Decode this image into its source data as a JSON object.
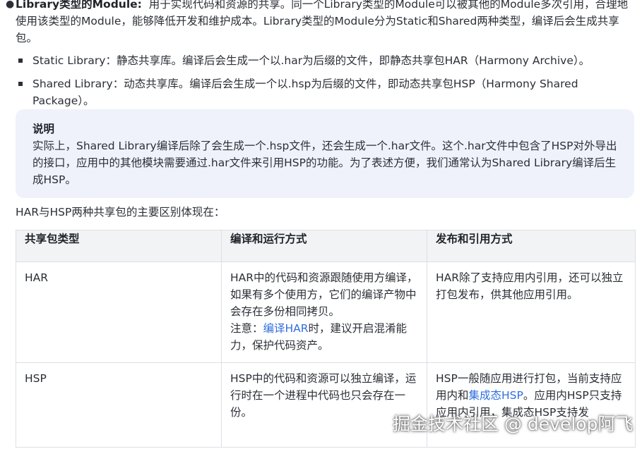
{
  "intro_item": {
    "title": "Library类型的Module:",
    "text": "用于实现代码和资源的共享。同一个Library类型的Module可以被其他的Module多次引用，合理地使用该类型的Module，能够降低开发和维护成本。Library类型的Module分为Static和Shared两种类型，编译后会生成共享包。",
    "sub_items": [
      {
        "text": "Static Library：静态共享库。编译后会生成一个以.har为后缀的文件，即静态共享包HAR（Harmony Archive）。"
      },
      {
        "text": "Shared Library：动态共享库。编译后会生成一个以.hsp为后缀的文件，即动态共享包HSP（Harmony Shared Package）。"
      }
    ]
  },
  "note": {
    "title": "说明",
    "body": "实际上，Shared Library编译后除了会生成一个.hsp文件，还会生成一个.har文件。这个.har文件中包含了HSP对外导出的接口，应用中的其他模块需要通过.har文件来引用HSP的功能。为了表述方便，我们通常认为Shared Library编译后生成HSP。"
  },
  "table_intro": "HAR与HSP两种共享包的主要区别体现在：",
  "table": {
    "headers": [
      "共享包类型",
      "编译和运行方式",
      "发布和引用方式"
    ],
    "har": {
      "type": "HAR",
      "compile": "HAR中的代码和资源跟随使用方编译，如果有多个使用方，它们的编译产物中会存在多份相同拷贝。",
      "note_prefix": "注意：",
      "note_link": "编译HAR",
      "note_suffix": "时，建议开启混淆能力，保护代码资产。",
      "publish": "HAR除了支持应用内引用，还可以独立打包发布，供其他应用引用。"
    },
    "hsp": {
      "type": "HSP",
      "compile": "HSP中的代码和资源可以独立编译，运行时在一个进程中代码也只会存在一份。",
      "publish_prefix": "HSP一般随应用进行打包，当前支持应用内和",
      "publish_link": "集成态HSP",
      "publish_suffix": "。应用内HSP只支持应用内引用，集成态HSP支持发"
    }
  },
  "watermark": "掘金技术社区 @ develop阿飞"
}
